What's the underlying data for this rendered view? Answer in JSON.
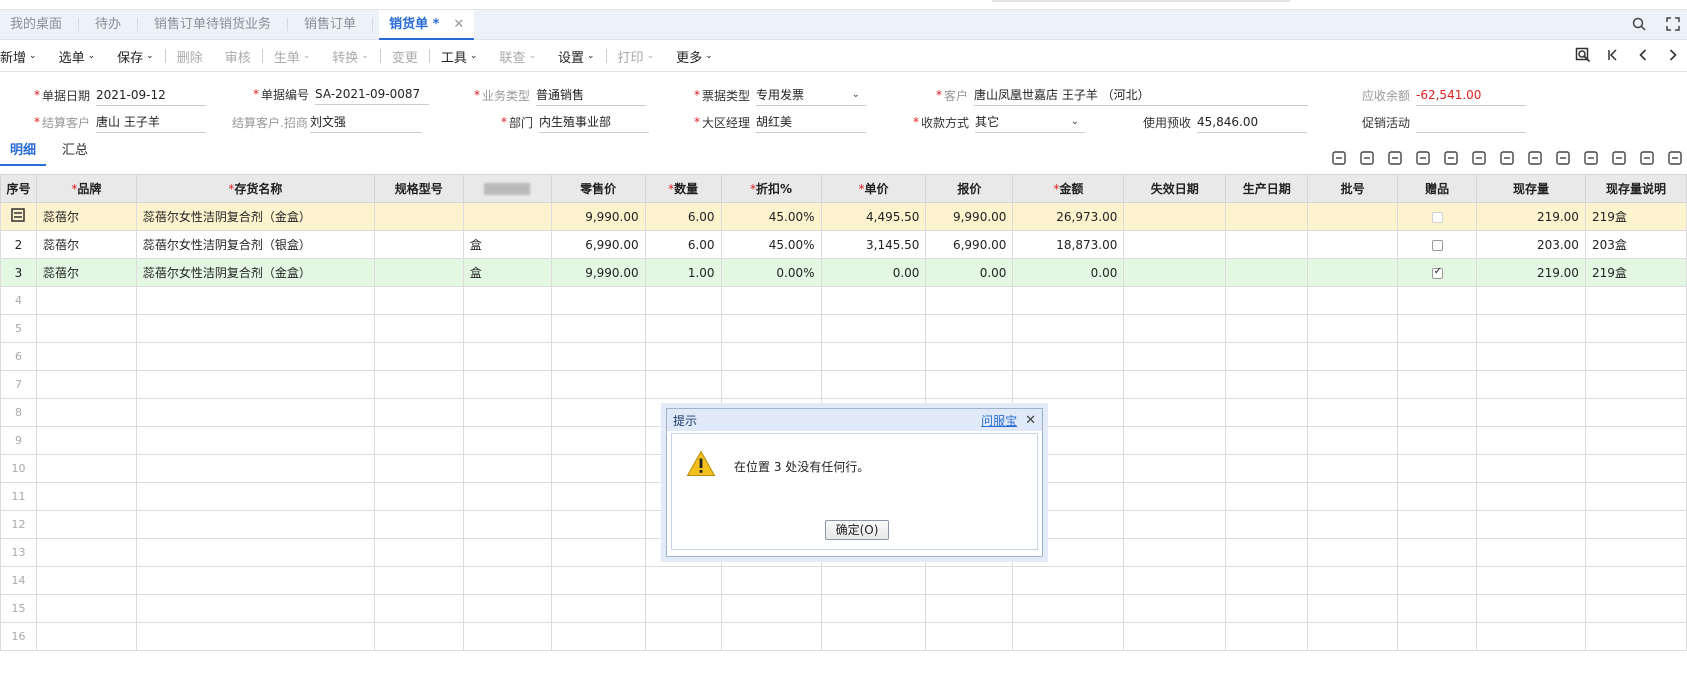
{
  "tabs": [
    {
      "label": "我的桌面",
      "active": false
    },
    {
      "label": "待办",
      "active": false
    },
    {
      "label": "销售订单待销货业务",
      "active": false
    },
    {
      "label": "销售订单",
      "active": false
    },
    {
      "label": "销货单 *",
      "active": true,
      "close": "✕"
    }
  ],
  "toolbar": {
    "items": [
      {
        "label": "新增",
        "caret": true,
        "disabled": false
      },
      {
        "label": "选单",
        "caret": true,
        "disabled": false
      },
      {
        "label": "保存",
        "caret": true,
        "disabled": false
      },
      {
        "label": "删除",
        "caret": false,
        "disabled": true
      },
      {
        "label": "审核",
        "caret": false,
        "disabled": true
      },
      {
        "label": "生单",
        "caret": true,
        "disabled": true
      },
      {
        "label": "转换",
        "caret": true,
        "disabled": true
      },
      {
        "label": "变更",
        "caret": false,
        "disabled": true
      },
      {
        "label": "工具",
        "caret": true,
        "disabled": false
      },
      {
        "label": "联查",
        "caret": true,
        "disabled": true
      },
      {
        "label": "设置",
        "caret": true,
        "disabled": false
      },
      {
        "label": "打印",
        "caret": true,
        "disabled": true
      },
      {
        "label": "更多",
        "caret": true,
        "disabled": false
      }
    ]
  },
  "form": {
    "doc_date": {
      "label": "单据日期",
      "value": "2021-09-12"
    },
    "doc_no": {
      "label": "单据编号",
      "value": "SA-2021-09-0087"
    },
    "biz_type": {
      "label": "业务类型",
      "value": "普通销售"
    },
    "invoice_type": {
      "label": "票据类型",
      "value": "专用发票"
    },
    "customer": {
      "label": "客户",
      "value": "唐山凤凰世嘉店 王子羊 （河北）"
    },
    "receivable": {
      "label": "应收余额",
      "value": "-62,541.00"
    },
    "settle_customer": {
      "label": "结算客户",
      "value": "唐山 王子羊"
    },
    "settle_merchant": {
      "label": "结算客户.招商",
      "value": "刘文强"
    },
    "department": {
      "label": "部门",
      "value": "内生殖事业部"
    },
    "region_manager": {
      "label": "大区经理",
      "value": "胡红美"
    },
    "payment_method": {
      "label": "收款方式",
      "value": "其它"
    },
    "prepaid": {
      "label": "使用预收",
      "value": "45,846.00"
    },
    "promotion": {
      "label": "促销活动",
      "value": ""
    }
  },
  "subtabs": [
    "明细",
    "汇总"
  ],
  "table": {
    "headers": [
      "序号",
      "品牌",
      "存货名称",
      "规格型号",
      "",
      "零售价",
      "数量",
      "折扣%",
      "单价",
      "报价",
      "金额",
      "失效日期",
      "生产日期",
      "批号",
      "赠品",
      "现存量",
      "现存量说明"
    ],
    "required": [
      false,
      true,
      true,
      false,
      false,
      false,
      true,
      true,
      true,
      false,
      true,
      false,
      false,
      false,
      false,
      false,
      false
    ],
    "rows": [
      {
        "seq": "",
        "brand": "蕊蓓尔",
        "name": "蕊蓓尔女性洁阴复合剂（金盒）",
        "spec": "",
        "unit": "",
        "retail": "9,990.00",
        "qty": "6.00",
        "discount": "45.00%",
        "price": "4,495.50",
        "quote": "9,990.00",
        "amount": "26,973.00",
        "expire": "",
        "produce": "",
        "batch": "",
        "gift": false,
        "stock": "219.00",
        "stock_desc": "219盒"
      },
      {
        "seq": "2",
        "brand": "蕊蓓尔",
        "name": "蕊蓓尔女性洁阴复合剂（银盒）",
        "spec": "",
        "unit": "盒",
        "retail": "6,990.00",
        "qty": "6.00",
        "discount": "45.00%",
        "price": "3,145.50",
        "quote": "6,990.00",
        "amount": "18,873.00",
        "expire": "",
        "produce": "",
        "batch": "",
        "gift": false,
        "stock": "203.00",
        "stock_desc": "203盒"
      },
      {
        "seq": "3",
        "brand": "蕊蓓尔",
        "name": "蕊蓓尔女性洁阴复合剂（金盒）",
        "spec": "",
        "unit": "盒",
        "retail": "9,990.00",
        "qty": "1.00",
        "discount": "0.00%",
        "price": "0.00",
        "quote": "0.00",
        "amount": "0.00",
        "expire": "",
        "produce": "",
        "batch": "",
        "gift": true,
        "stock": "219.00",
        "stock_desc": "219盒"
      }
    ],
    "empty_rows": [
      "4",
      "5",
      "6",
      "7",
      "8",
      "9",
      "10",
      "11",
      "12",
      "13",
      "14",
      "15",
      "16"
    ]
  },
  "dialog": {
    "title": "提示",
    "link": "问服宝",
    "close": "✕",
    "message": "在位置 3 处没有任何行。",
    "ok_label": "确定(O)"
  }
}
